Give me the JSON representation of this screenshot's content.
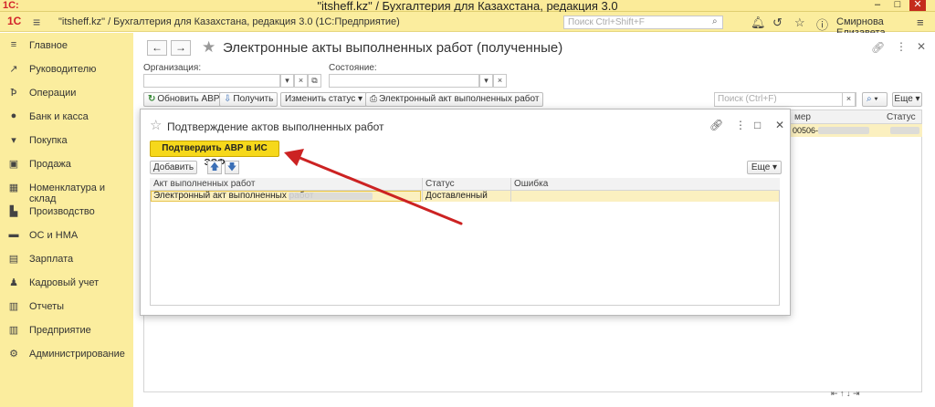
{
  "window": {
    "title": "\"itsheff.kz\" / Бухгалтерия для Казахстана, редакция 3.0",
    "logo": "1С:",
    "min": "–",
    "max": "□",
    "close": "✕"
  },
  "header": {
    "title": "\"itsheff.kz\" / Бухгалтерия для Казахстана, редакция 3.0  (1С:Предприятие)",
    "search_placeholder": "Поиск Ctrl+Shift+F",
    "user": "Смирнова Елизавета"
  },
  "sidebar": {
    "items": [
      {
        "label": "Главное",
        "icon": "≡"
      },
      {
        "label": "Руководителю",
        "icon": "↗"
      },
      {
        "label": "Операции",
        "icon": "Ꝥ"
      },
      {
        "label": "Банк и касса",
        "icon": "●"
      },
      {
        "label": "Покупка",
        "icon": "▾"
      },
      {
        "label": "Продажа",
        "icon": "▣"
      },
      {
        "label": "Номенклатура и склад",
        "icon": "▦"
      },
      {
        "label": "Производство",
        "icon": "▙"
      },
      {
        "label": "ОС и НМА",
        "icon": "▬"
      },
      {
        "label": "Зарплата",
        "icon": "▤"
      },
      {
        "label": "Кадровый учет",
        "icon": "♟"
      },
      {
        "label": "Отчеты",
        "icon": "▥"
      },
      {
        "label": "Предприятие",
        "icon": "▥"
      },
      {
        "label": "Администрирование",
        "icon": "⚙"
      }
    ]
  },
  "page": {
    "title": "Электронные акты выполненных работ (полученные)",
    "filters": {
      "organization_label": "Организация:",
      "state_label": "Состояние:"
    },
    "toolbar": {
      "refresh": "Обновить АВР",
      "receive": "Получить",
      "change_status": "Изменить статус",
      "print": "Электронный акт выполненных работ",
      "search_placeholder": "Поиск (Ctrl+F)",
      "more": "Еще"
    },
    "grid": {
      "col_number": "мер",
      "col_status": "Статус",
      "row_number_prefix": "00506-"
    }
  },
  "dialog": {
    "title": "Подтверждение актов выполненных работ",
    "confirm": "Подтвердить АВР в ИС ЭСФ",
    "add": "Добавить",
    "more": "Еще",
    "columns": [
      "Акт выполненных работ",
      "Статус",
      "Ошибка"
    ],
    "rows": [
      {
        "act": "Электронный акт выполненных работ",
        "status": "Доставленный",
        "error": ""
      }
    ]
  },
  "colors": {
    "header_bg": "#fbed9e",
    "confirm_bg": "#f6d81b",
    "selected_row": "#fbf0c0",
    "annotation_arrow": "#cc2222"
  }
}
